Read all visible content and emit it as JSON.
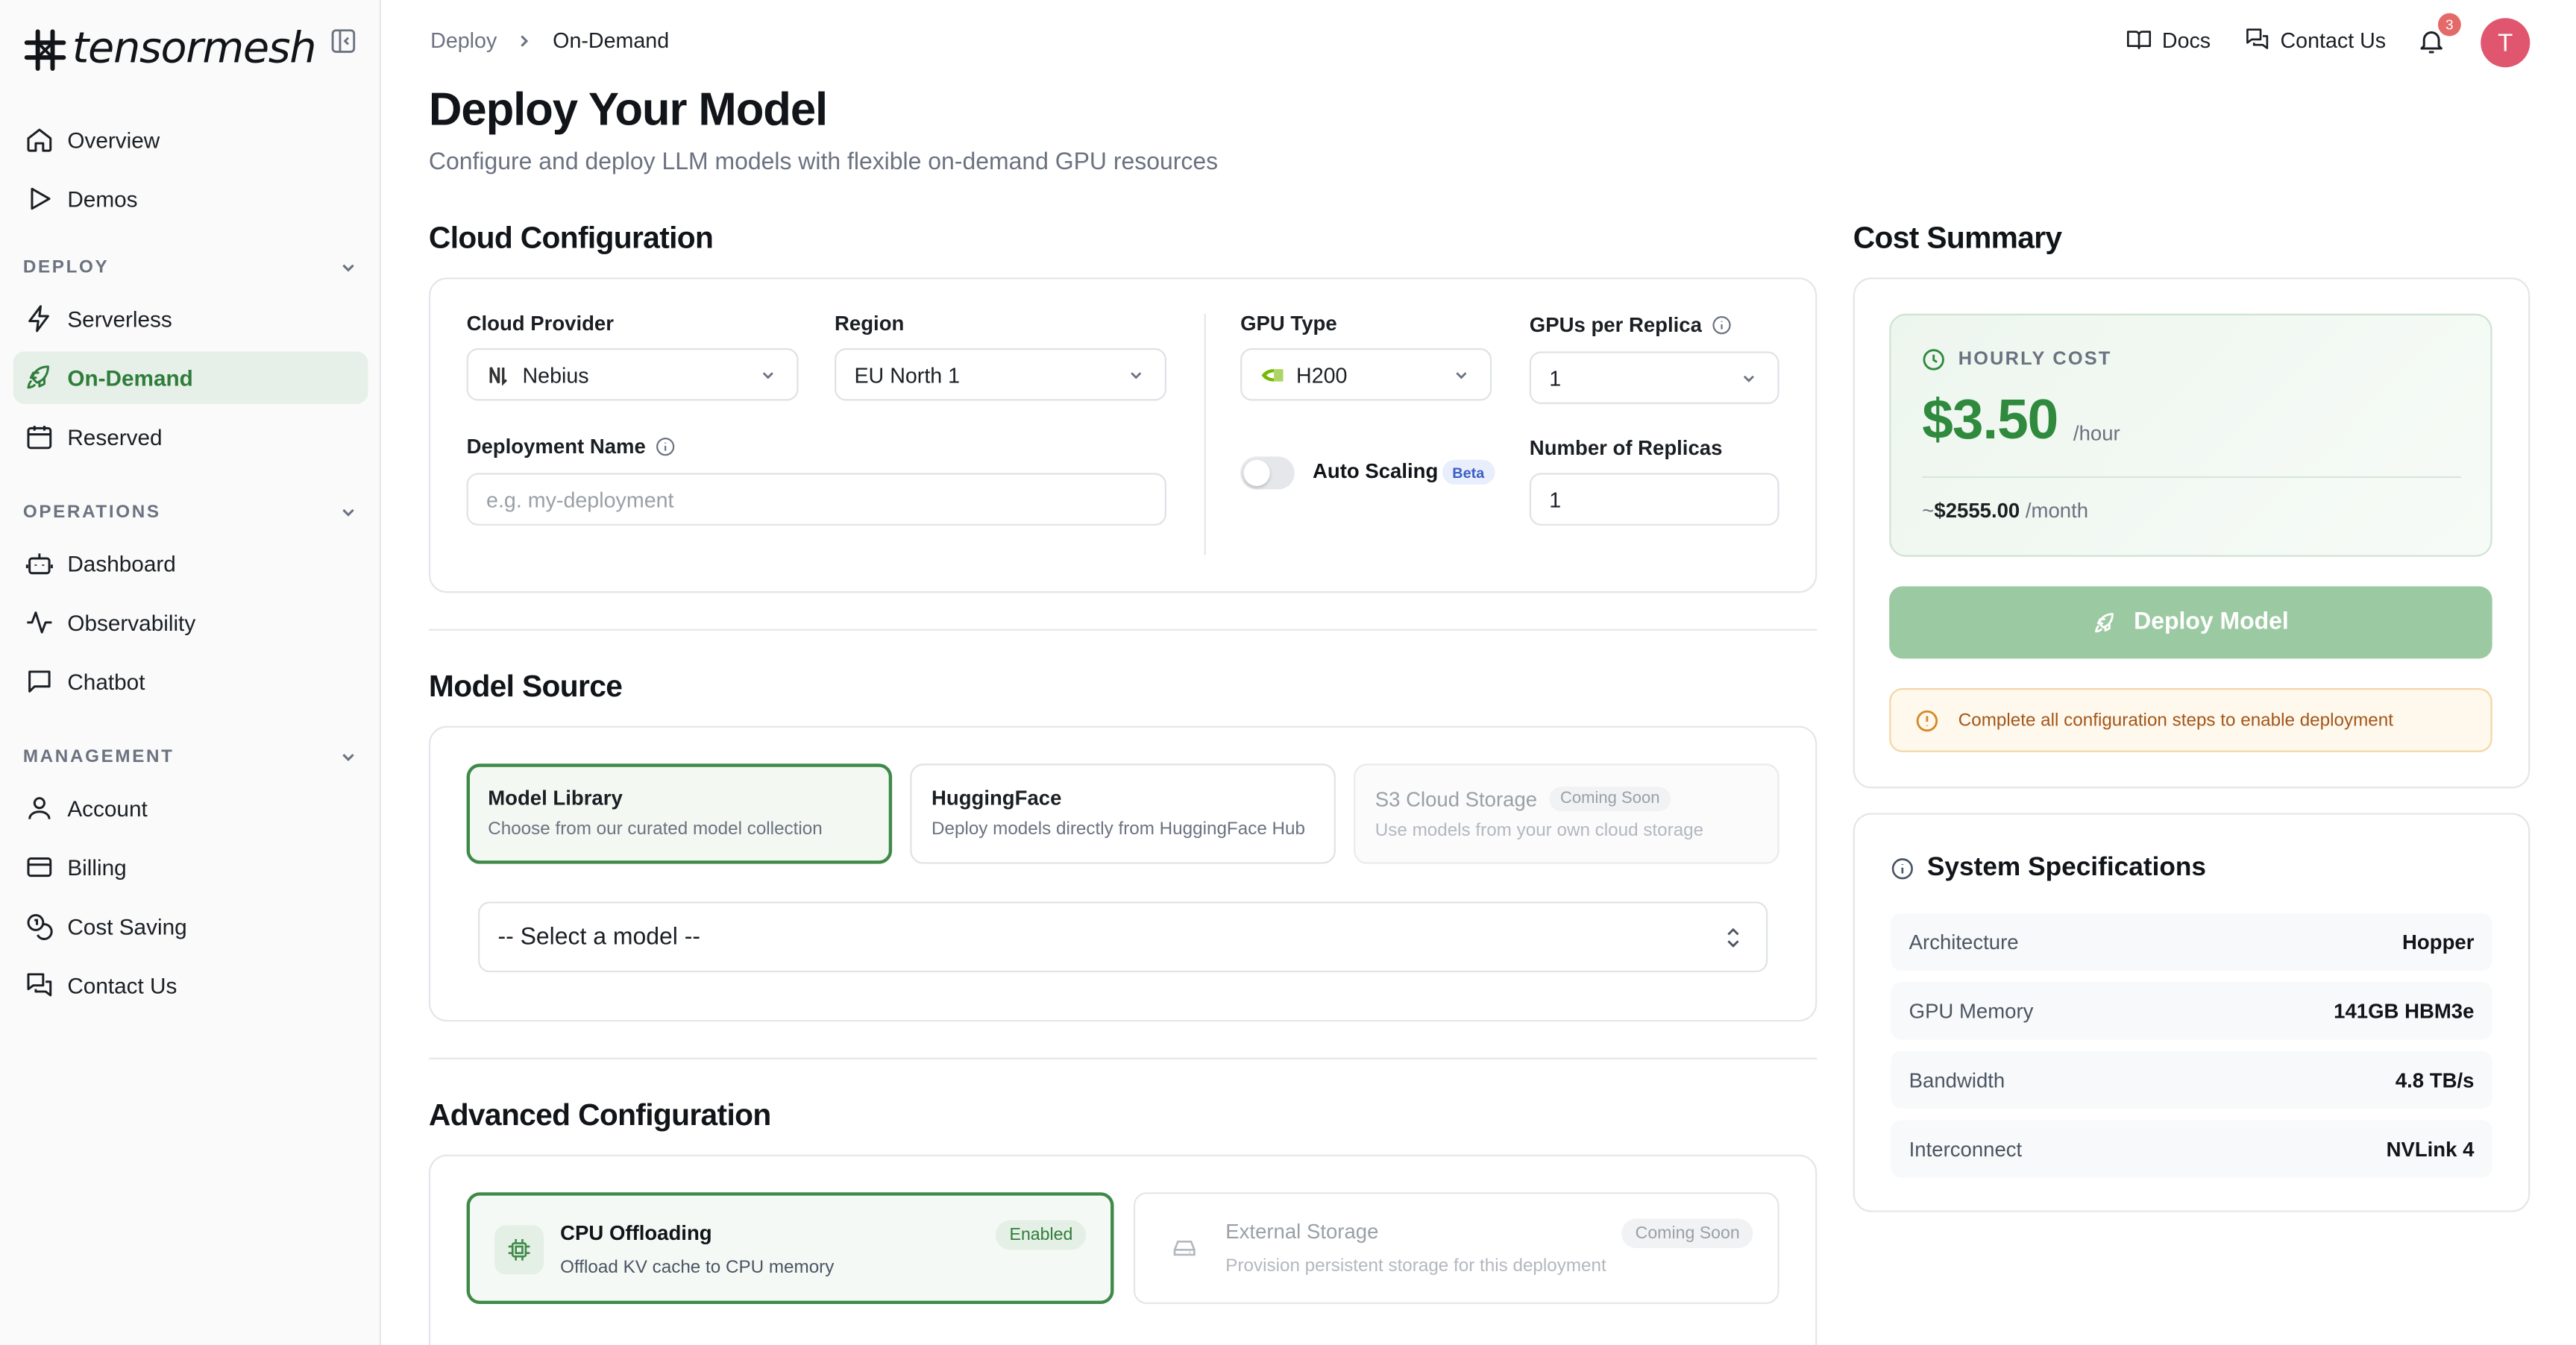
{
  "brand": {
    "name": "tensormesh"
  },
  "sidebar": {
    "top_items": [
      {
        "label": "Overview",
        "icon": "home-icon"
      },
      {
        "label": "Demos",
        "icon": "play-icon"
      }
    ],
    "sections": [
      {
        "title": "DEPLOY",
        "items": [
          {
            "label": "Serverless",
            "icon": "lightning-icon"
          },
          {
            "label": "On-Demand",
            "icon": "rocket-icon",
            "active": true
          },
          {
            "label": "Reserved",
            "icon": "calendar-icon"
          }
        ]
      },
      {
        "title": "OPERATIONS",
        "items": [
          {
            "label": "Dashboard",
            "icon": "robot-icon"
          },
          {
            "label": "Observability",
            "icon": "activity-icon"
          },
          {
            "label": "Chatbot",
            "icon": "chat-icon"
          }
        ]
      },
      {
        "title": "MANAGEMENT",
        "items": [
          {
            "label": "Account",
            "icon": "user-icon"
          },
          {
            "label": "Billing",
            "icon": "card-icon"
          },
          {
            "label": "Cost Saving",
            "icon": "coins-icon"
          },
          {
            "label": "Contact Us",
            "icon": "messages-icon"
          }
        ]
      }
    ]
  },
  "topbar": {
    "breadcrumb": [
      "Deploy",
      "On-Demand"
    ],
    "docs": "Docs",
    "contact": "Contact Us",
    "notifications": "3",
    "avatar": "T"
  },
  "page": {
    "title": "Deploy Your Model",
    "subtitle": "Configure and deploy LLM models with flexible on-demand GPU resources"
  },
  "cloud": {
    "heading": "Cloud Configuration",
    "provider_label": "Cloud Provider",
    "provider_value": "Nebius",
    "region_label": "Region",
    "region_value": "EU North 1",
    "name_label": "Deployment Name",
    "name_placeholder": "e.g. my-deployment",
    "gpu_label": "GPU Type",
    "gpu_value": "H200",
    "gpr_label": "GPUs per Replica",
    "gpr_value": "1",
    "autoscale_label": "Auto Scaling",
    "autoscale_on": false,
    "beta": "Beta",
    "replicas_label": "Number of Replicas",
    "replicas_value": "1"
  },
  "model_source": {
    "heading": "Model Source",
    "options": [
      {
        "title": "Model Library",
        "desc": "Choose from our curated model collection",
        "selected": true
      },
      {
        "title": "HuggingFace",
        "desc": "Deploy models directly from HuggingFace Hub"
      },
      {
        "title": "S3 Cloud Storage",
        "badge": "Coming Soon",
        "desc": "Use models from your own cloud storage",
        "disabled": true
      }
    ],
    "select_placeholder": "-- Select a model --"
  },
  "advanced": {
    "heading": "Advanced Configuration",
    "cpu": {
      "title": "CPU Offloading",
      "desc": "Offload KV cache to CPU memory",
      "badge": "Enabled"
    },
    "storage": {
      "title": "External Storage",
      "desc": "Provision persistent storage for this deployment",
      "badge": "Coming Soon"
    }
  },
  "cost": {
    "heading": "Cost Summary",
    "label": "HOURLY COST",
    "value": "$3.50",
    "unit": "/hour",
    "monthly_prefix": "~",
    "monthly_value": "$2555.00",
    "monthly_unit": " /month",
    "deploy_button": "Deploy Model",
    "warning": "Complete all configuration steps to enable deployment"
  },
  "specs": {
    "title": "System Specifications",
    "rows": [
      {
        "k": "Architecture",
        "v": "Hopper"
      },
      {
        "k": "GPU Memory",
        "v": "141GB HBM3e"
      },
      {
        "k": "Bandwidth",
        "v": "4.8 TB/s"
      },
      {
        "k": "Interconnect",
        "v": "NVLink 4"
      }
    ]
  },
  "colors": {
    "accent": "#2f7d3b",
    "accent_light": "#e7f0e8",
    "warning": "#a2561a",
    "avatar": "#e0566f"
  }
}
